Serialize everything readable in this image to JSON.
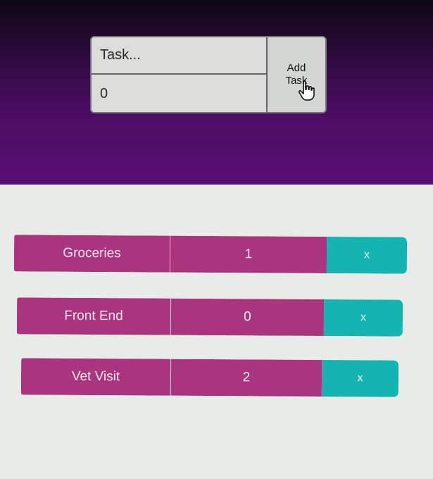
{
  "form": {
    "task_placeholder": "Task...",
    "quantity_value": "0",
    "add_button_label": "Add Task"
  },
  "tasks": [
    {
      "name": "Groceries",
      "count": "1",
      "delete_label": "x"
    },
    {
      "name": "Front End",
      "count": "0",
      "delete_label": "x"
    },
    {
      "name": "Vet Visit",
      "count": "2",
      "delete_label": "x"
    }
  ],
  "colors": {
    "header_top": "#0c0711",
    "header_bottom": "#5a0f72",
    "task_cell": "#a8357e",
    "delete_cell": "#16b4b0",
    "page_background": "#e8ece8"
  },
  "icons": {
    "cursor": "hand-pointer-icon"
  }
}
